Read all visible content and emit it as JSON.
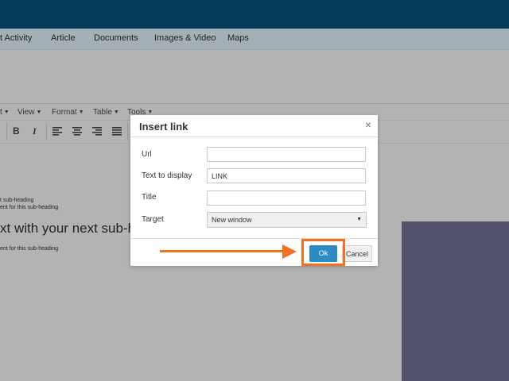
{
  "nav": {
    "items": [
      "t Activity",
      "Article",
      "Documents",
      "Images & Video",
      "Maps"
    ]
  },
  "editor": {
    "menus": [
      "t",
      "View",
      "Format",
      "Table",
      "Tools"
    ],
    "toolbar": [
      "B",
      "I"
    ]
  },
  "content": {
    "line1": "t sub-heading",
    "line2": "ent for this sub-heading",
    "heading": "xt with your next sub-hea",
    "line3": "ent for this sub-heading"
  },
  "dialog": {
    "title": "Insert link",
    "close_label": "×",
    "fields": {
      "url": {
        "label": "Url",
        "value": ""
      },
      "text": {
        "label": "Text to display",
        "value": "LINK"
      },
      "title": {
        "label": "Title",
        "value": ""
      },
      "target": {
        "label": "Target",
        "value": "New window"
      }
    },
    "ok_label": "Ok",
    "cancel_label": "Cancel"
  },
  "colors": {
    "topbar": "#073b5e",
    "highlight": "#f36f21",
    "ok_button": "#2d8ac7",
    "side_panel": "#53536e"
  }
}
